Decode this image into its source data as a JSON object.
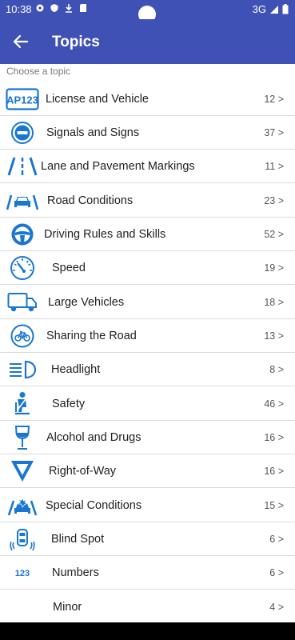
{
  "status": {
    "time": "10:38",
    "network": "3G"
  },
  "appbar": {
    "title": "Topics"
  },
  "hint": "Choose a topic",
  "colors": {
    "primary": "#3f51b5",
    "icon": "#1976d2"
  },
  "topics": [
    {
      "label": "License and Vehicle",
      "count": "12 >",
      "icon": "license-plate-icon"
    },
    {
      "label": "Signals and Signs",
      "count": "37 >",
      "icon": "no-entry-sign-icon"
    },
    {
      "label": "Lane and Pavement Markings",
      "count": "11 >",
      "icon": "lane-markings-icon"
    },
    {
      "label": "Road Conditions",
      "count": "23 >",
      "icon": "road-car-icon"
    },
    {
      "label": "Driving Rules and Skills",
      "count": "52 >",
      "icon": "steering-wheel-icon"
    },
    {
      "label": "Speed",
      "count": "19 >",
      "icon": "speedometer-icon"
    },
    {
      "label": "Large Vehicles",
      "count": "18 >",
      "icon": "truck-icon"
    },
    {
      "label": "Sharing the Road",
      "count": "13 >",
      "icon": "bicycle-icon"
    },
    {
      "label": "Headlight",
      "count": "8 >",
      "icon": "headlight-icon"
    },
    {
      "label": "Safety",
      "count": "46 >",
      "icon": "seatbelt-icon"
    },
    {
      "label": "Alcohol and Drugs",
      "count": "16 >",
      "icon": "wine-glass-icon"
    },
    {
      "label": "Right-of-Way",
      "count": "16 >",
      "icon": "yield-sign-icon"
    },
    {
      "label": "Special Conditions",
      "count": "15 >",
      "icon": "crash-icon"
    },
    {
      "label": "Blind Spot",
      "count": "6 >",
      "icon": "blind-spot-icon"
    },
    {
      "label": "Numbers",
      "count": "6 >",
      "icon": "numbers-icon"
    },
    {
      "label": "Minor",
      "count": "4 >",
      "icon": ""
    }
  ]
}
